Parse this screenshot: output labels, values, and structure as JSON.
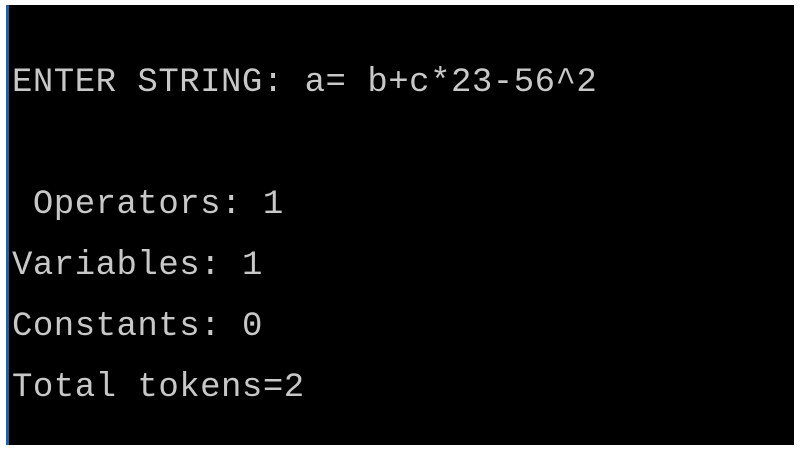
{
  "console": {
    "lines": [
      {
        "label": "ENTER STRING:",
        "value": "a= b+c*23-56^2"
      },
      {
        "label": " Operators:",
        "value": "1"
      },
      {
        "label": "Variables:",
        "value": "1"
      },
      {
        "label": "Constants:",
        "value": "0"
      },
      {
        "text": "Total tokens=2"
      }
    ]
  }
}
